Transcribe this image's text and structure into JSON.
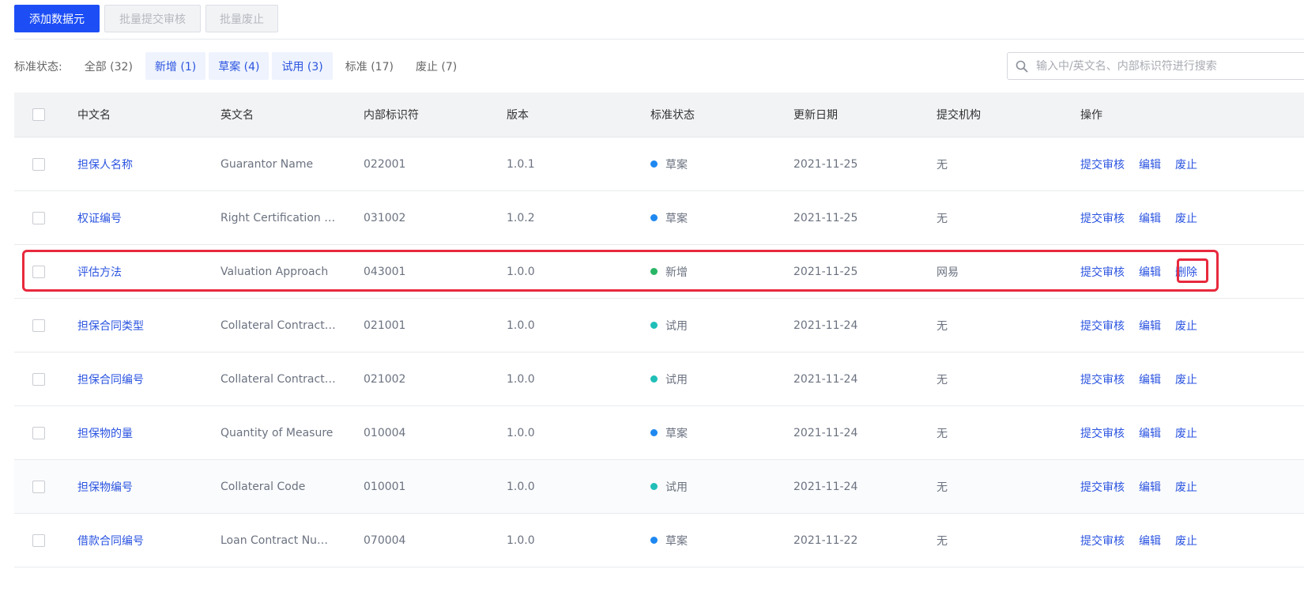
{
  "toolbar": {
    "add_label": "添加数据元",
    "batch_submit_label": "批量提交审核",
    "batch_abolish_label": "批量废止"
  },
  "filter": {
    "label": "标准状态:",
    "chips": [
      {
        "label": "全部 (32)",
        "active": false
      },
      {
        "label": "新增 (1)",
        "active": true
      },
      {
        "label": "草案 (4)",
        "active": true
      },
      {
        "label": "试用 (3)",
        "active": true
      },
      {
        "label": "标准 (17)",
        "active": false
      },
      {
        "label": "废止 (7)",
        "active": false
      }
    ]
  },
  "search": {
    "placeholder": "输入中/英文名、内部标识符进行搜索",
    "icon": "search-icon"
  },
  "table": {
    "headers": {
      "cn": "中文名",
      "en": "英文名",
      "id": "内部标识符",
      "ver": "版本",
      "status": "标准状态",
      "date": "更新日期",
      "org": "提交机构",
      "ops": "操作"
    },
    "rows": [
      {
        "cn": "担保人名称",
        "en": "Guarantor Name",
        "id": "022001",
        "ver": "1.0.1",
        "status": "草案",
        "status_color": "#1e88f0",
        "date": "2021-11-25",
        "org": "无",
        "ops": [
          "提交审核",
          "编辑",
          "废止"
        ]
      },
      {
        "cn": "权证编号",
        "en": "Right Certification N...",
        "id": "031002",
        "ver": "1.0.2",
        "status": "草案",
        "status_color": "#1e88f0",
        "date": "2021-11-25",
        "org": "无",
        "ops": [
          "提交审核",
          "编辑",
          "废止"
        ]
      },
      {
        "cn": "评估方法",
        "en": "Valuation Approach",
        "id": "043001",
        "ver": "1.0.0",
        "status": "新增",
        "status_color": "#28b566",
        "date": "2021-11-25",
        "org": "网易",
        "ops": [
          "提交审核",
          "编辑",
          "删除"
        ]
      },
      {
        "cn": "担保合同类型",
        "en": "Collateral Contract ...",
        "id": "021001",
        "ver": "1.0.0",
        "status": "试用",
        "status_color": "#1fbfb8",
        "date": "2021-11-24",
        "org": "无",
        "ops": [
          "提交审核",
          "编辑",
          "废止"
        ]
      },
      {
        "cn": "担保合同编号",
        "en": "Collateral Contract ...",
        "id": "021002",
        "ver": "1.0.0",
        "status": "试用",
        "status_color": "#1fbfb8",
        "date": "2021-11-24",
        "org": "无",
        "ops": [
          "提交审核",
          "编辑",
          "废止"
        ]
      },
      {
        "cn": "担保物的量",
        "en": "Quantity of Measure",
        "id": "010004",
        "ver": "1.0.0",
        "status": "草案",
        "status_color": "#1e88f0",
        "date": "2021-11-24",
        "org": "无",
        "ops": [
          "提交审核",
          "编辑",
          "废止"
        ]
      },
      {
        "cn": "担保物编号",
        "en": "Collateral Code",
        "id": "010001",
        "ver": "1.0.0",
        "status": "试用",
        "status_color": "#1fbfb8",
        "date": "2021-11-24",
        "org": "无",
        "ops": [
          "提交审核",
          "编辑",
          "废止"
        ]
      },
      {
        "cn": "借款合同编号",
        "en": "Loan Contract Num...",
        "id": "070004",
        "ver": "1.0.0",
        "status": "草案",
        "status_color": "#1e88f0",
        "date": "2021-11-22",
        "org": "无",
        "ops": [
          "提交审核",
          "编辑",
          "废止"
        ]
      }
    ]
  },
  "annotation": {
    "highlight_color": "#e8293d",
    "highlighted_row_index": 2,
    "highlighted_op_index": 2
  }
}
